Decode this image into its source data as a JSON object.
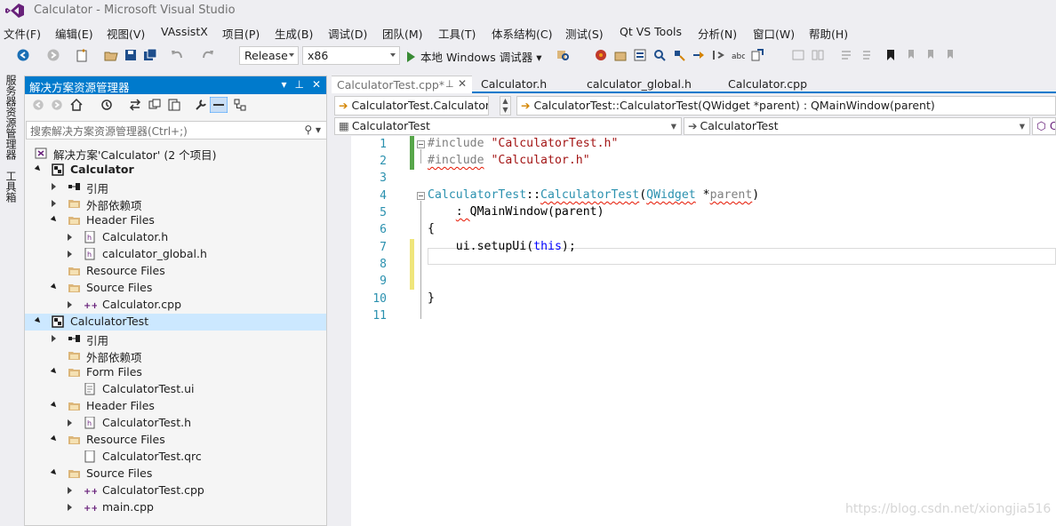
{
  "window": {
    "title": "Calculator - Microsoft Visual Studio"
  },
  "menu": [
    "文件(F)",
    "编辑(E)",
    "视图(V)",
    "VAssistX",
    "项目(P)",
    "生成(B)",
    "调试(D)",
    "团队(M)",
    "工具(T)",
    "体系结构(C)",
    "测试(S)",
    "Qt VS Tools",
    "分析(N)",
    "窗口(W)",
    "帮助(H)"
  ],
  "toolbar": {
    "config": "Release",
    "platform": "x86",
    "run_label": "本地 Windows 调试器"
  },
  "left_strip": {
    "server_explorer": "服务器资源管理器",
    "toolbox": "工具箱"
  },
  "solution_explorer": {
    "title": "解决方案资源管理器",
    "search_placeholder": "搜索解决方案资源管理器(Ctrl+;)",
    "tree": [
      {
        "label": "解决方案'Calculator' (2 个项目)",
        "icon": "solution-icon"
      },
      {
        "label": "Calculator",
        "icon": "project-icon",
        "bold": true
      },
      {
        "label": "引用",
        "icon": "references-icon"
      },
      {
        "label": "外部依赖项",
        "icon": "folder-icon"
      },
      {
        "label": "Header Files",
        "icon": "folder-icon"
      },
      {
        "label": "Calculator.h",
        "icon": "header-file-icon"
      },
      {
        "label": "calculator_global.h",
        "icon": "header-file-icon"
      },
      {
        "label": "Resource Files",
        "icon": "folder-icon"
      },
      {
        "label": "Source Files",
        "icon": "folder-icon"
      },
      {
        "label": "Calculator.cpp",
        "icon": "cpp-file-icon"
      },
      {
        "label": "CalculatorTest",
        "icon": "project-icon",
        "selected": true
      },
      {
        "label": "引用",
        "icon": "references-icon"
      },
      {
        "label": "外部依赖项",
        "icon": "folder-icon"
      },
      {
        "label": "Form Files",
        "icon": "folder-icon"
      },
      {
        "label": "CalculatorTest.ui",
        "icon": "ui-file-icon"
      },
      {
        "label": "Header Files",
        "icon": "folder-icon"
      },
      {
        "label": "CalculatorTest.h",
        "icon": "header-file-icon"
      },
      {
        "label": "Resource Files",
        "icon": "folder-icon"
      },
      {
        "label": "CalculatorTest.qrc",
        "icon": "qrc-file-icon"
      },
      {
        "label": "Source Files",
        "icon": "folder-icon"
      },
      {
        "label": "CalculatorTest.cpp",
        "icon": "cpp-file-icon"
      },
      {
        "label": "main.cpp",
        "icon": "cpp-file-icon"
      }
    ]
  },
  "editor": {
    "tabs": [
      "CalculatorTest.cpp*",
      "Calculator.h",
      "calculator_global.h",
      "Calculator.cpp"
    ],
    "pin": "⊕",
    "nav": {
      "scope": "CalculatorTest.Calculator",
      "member": "CalculatorTest::CalculatorTest(QWidget *parent) : QMainWindow(parent)",
      "class_left": "CalculatorTest",
      "class_right": "CalculatorTest"
    },
    "line_numbers": [
      "1",
      "2",
      "3",
      "4",
      "5",
      "6",
      "7",
      "8",
      "9",
      "10",
      "11"
    ],
    "code": {
      "l1_pp": "#include",
      "l1_str": "\"CalculatorTest.h\"",
      "l2_pp": "#include",
      "l2_str": "\"Calculator.h\"",
      "l4_ty": "CalculatorTest",
      "l4_sep": "::",
      "l4_fn": "CalculatorTest",
      "l4_paren": "(",
      "l4_param_ty": "QWidget",
      "l4_star": " *",
      "l4_param": "parent",
      "l4_close": ")",
      "l5_colon": ": ",
      "l5_base": "QMainWindow",
      "l5_open": "(",
      "l5_arg": "parent",
      "l5_close": ")",
      "l6": "{",
      "l7_obj": "ui",
      "l7_dot": ".",
      "l7_fn": "setupUi",
      "l7_open": "(",
      "l7_kw": "this",
      "l7_close": ");",
      "l10": "}"
    }
  },
  "watermark": "https://blog.csdn.net/xiongjia516"
}
